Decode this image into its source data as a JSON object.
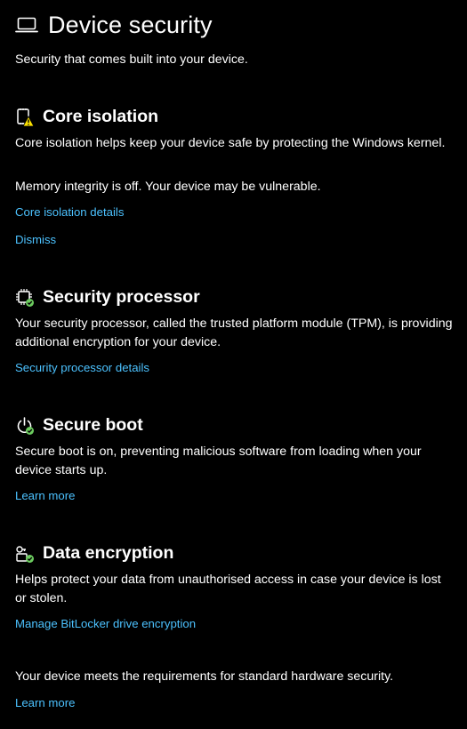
{
  "header": {
    "title": "Device security",
    "icon": "laptop-icon",
    "subtitle": "Security that comes built into your device."
  },
  "sections": {
    "core": {
      "title": "Core isolation",
      "icon": "core-isolation-warning-icon",
      "description": "Core isolation helps keep your device safe by protecting the Windows kernel.",
      "status": "Memory integrity is off. Your device may be vulnerable.",
      "link1": "Core isolation details",
      "link2": "Dismiss"
    },
    "processor": {
      "title": "Security processor",
      "icon": "chip-check-icon",
      "description": "Your security processor, called the trusted platform module (TPM), is providing additional encryption for your device.",
      "link1": "Security processor details"
    },
    "boot": {
      "title": "Secure boot",
      "icon": "power-check-icon",
      "description": "Secure boot is on, preventing malicious software from loading when your device starts up.",
      "link1": "Learn more"
    },
    "encryption": {
      "title": "Data encryption",
      "icon": "key-lock-check-icon",
      "description": "Helps protect your data from unauthorised access in case your device is lost or stolen.",
      "link1": "Manage BitLocker drive encryption"
    }
  },
  "footer": {
    "text": "Your device meets the requirements for standard hardware security.",
    "link": "Learn more"
  },
  "colors": {
    "background": "#000000",
    "text": "#ffffff",
    "link": "#4cc2ff",
    "check": "#6ccb5f",
    "warning": "#fce100"
  }
}
